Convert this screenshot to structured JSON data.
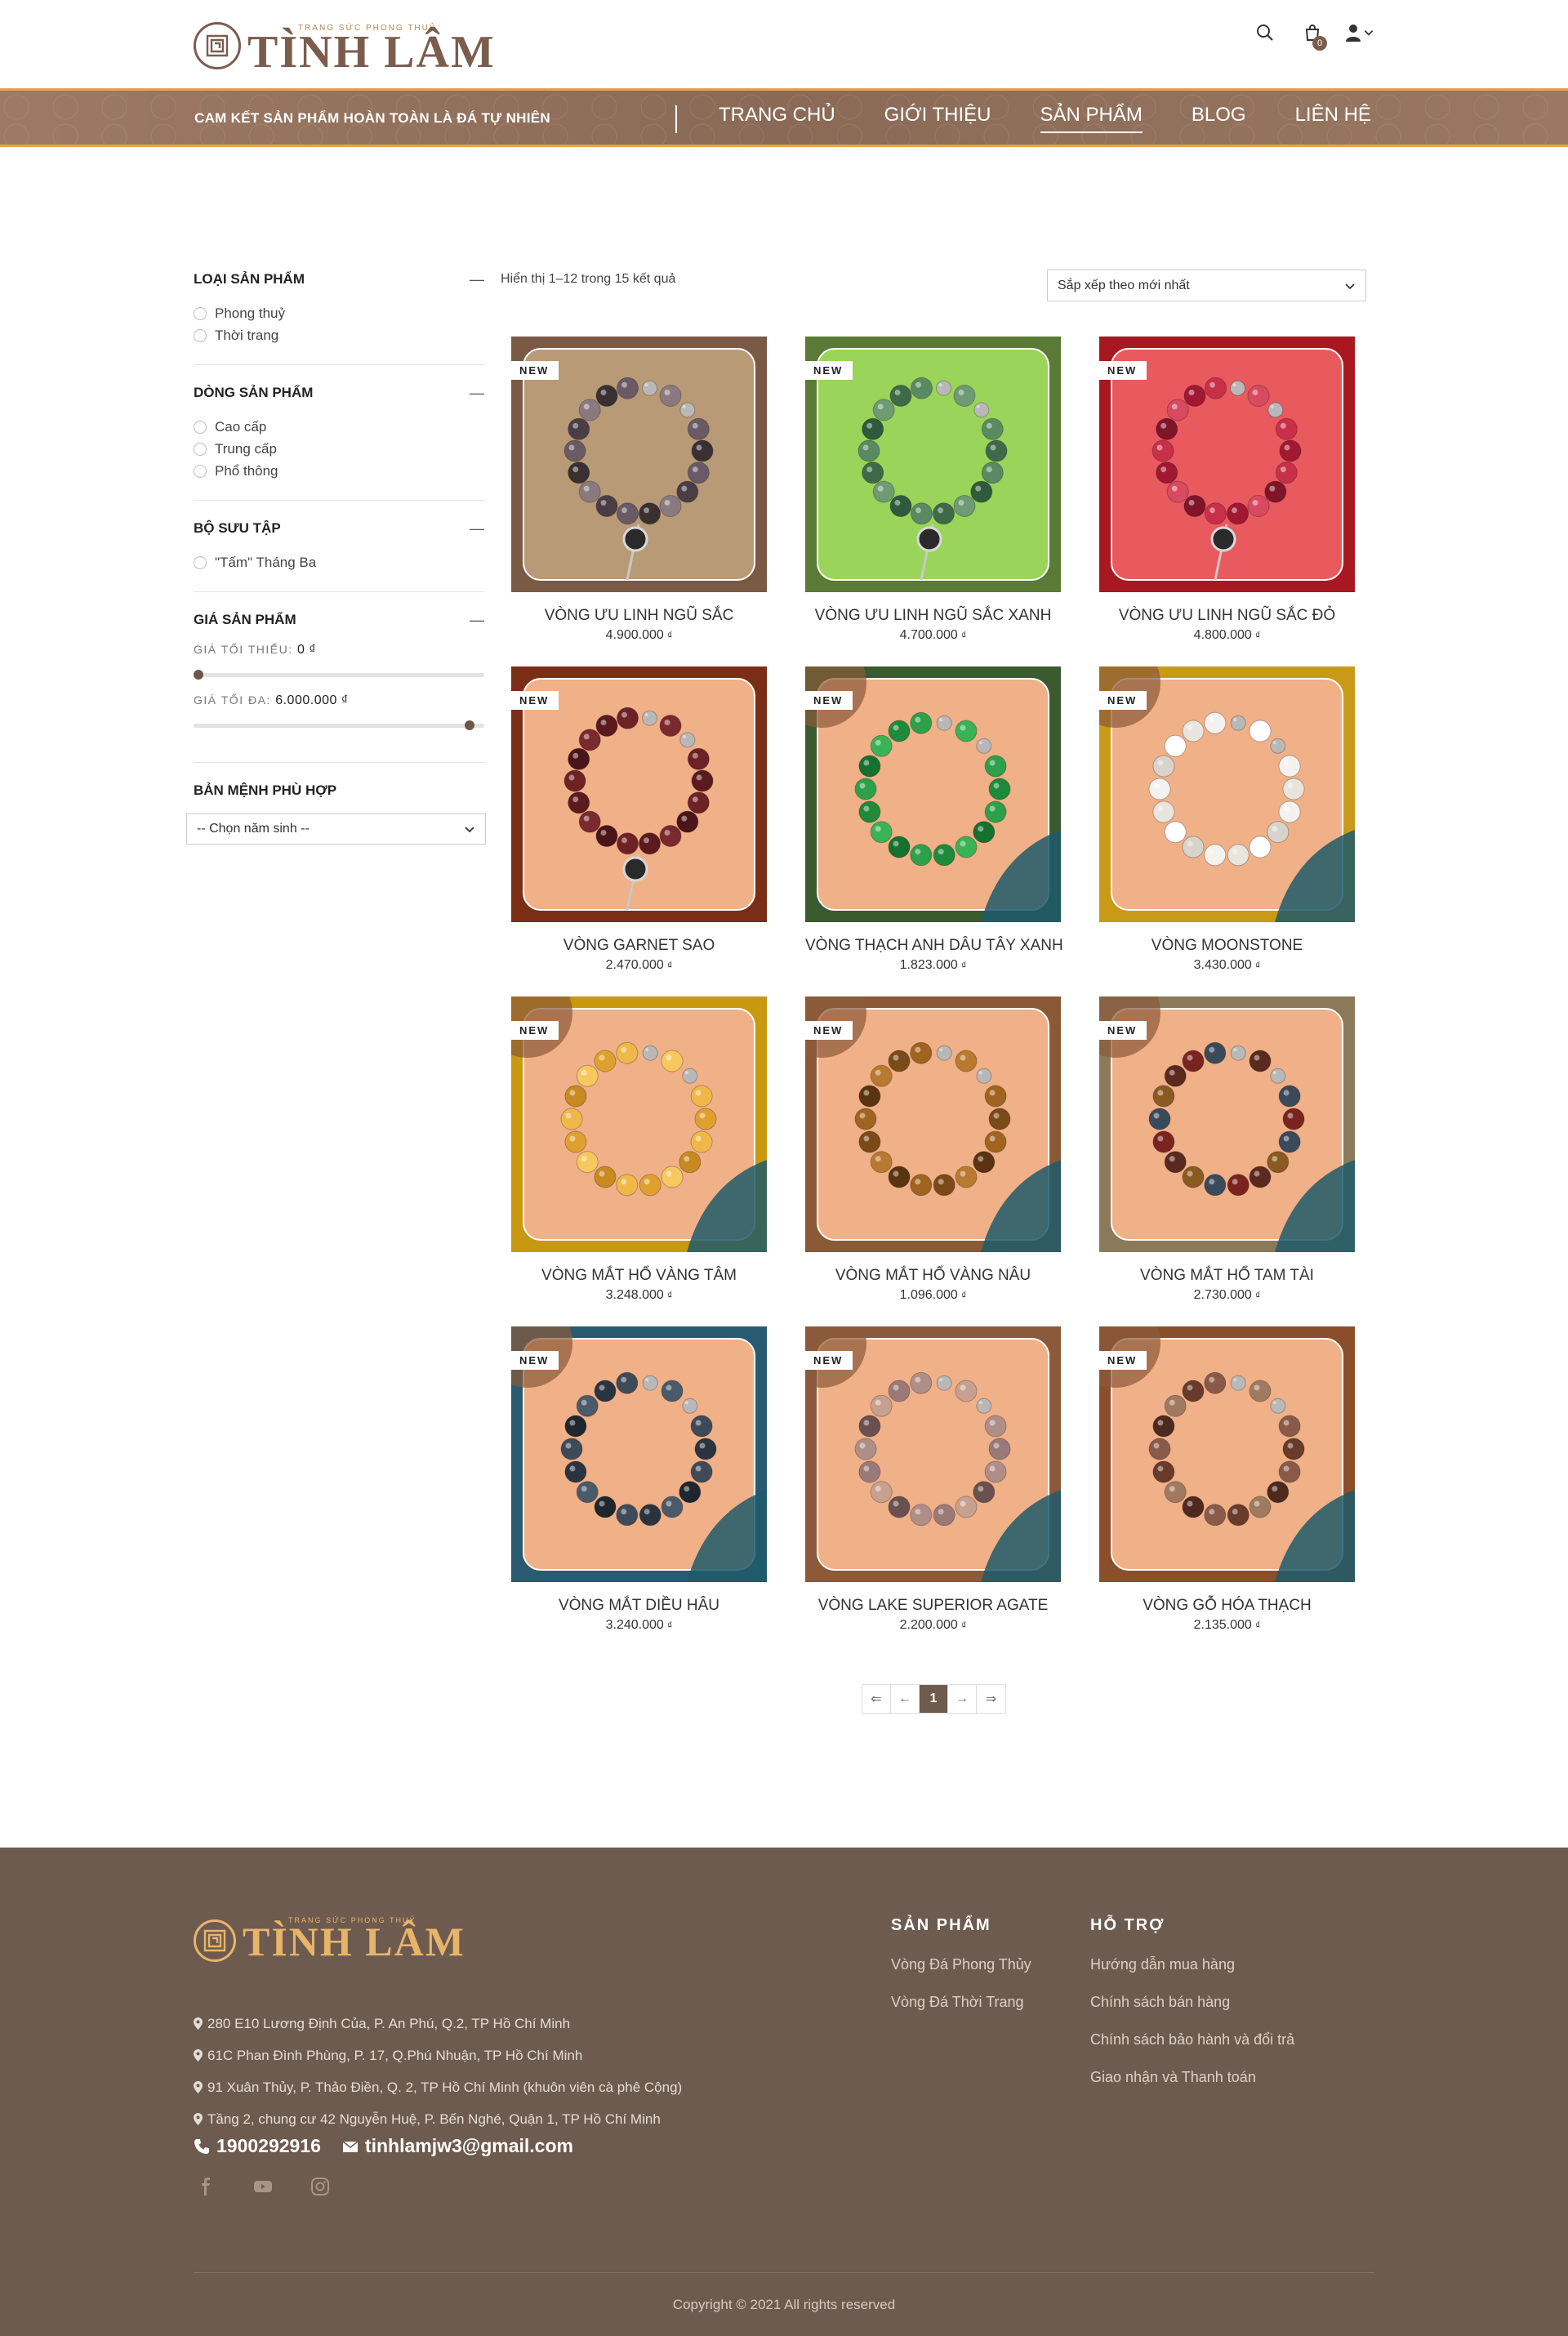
{
  "header": {
    "logo": {
      "tagline": "TRANG SỨC PHONG THUỶ",
      "name": "TÌNH LÂM"
    },
    "cart_count": "0",
    "promo": "CAM KẾT SẢN PHẨM HOÀN TOÀN LÀ ĐÁ TỰ NHIÊN",
    "nav": [
      "TRANG CHỦ",
      "GIỚI THIỆU",
      "SẢN PHẨM",
      "BLOG",
      "LIÊN HỆ"
    ],
    "nav_active": "SẢN PHẨM",
    "icons": [
      "search-icon",
      "cart-icon",
      "user-icon",
      "chevron-down-icon"
    ]
  },
  "sidebar": {
    "categories": {
      "title": "LOẠI SẢN PHẨM",
      "options": [
        "Phong thuỷ",
        "Thời trang"
      ]
    },
    "lines": {
      "title": "DÒNG SẢN PHẨM",
      "options": [
        "Cao cấp",
        "Trung cấp",
        "Phổ thông"
      ]
    },
    "collections": {
      "title": "BỘ SƯU TẬP",
      "options": [
        "\"Tấm\" Tháng Ba"
      ]
    },
    "price": {
      "title": "GIÁ SẢN PHẨM",
      "min_label": "GIÁ TỐI THIỂU:",
      "min_value": "0 ₫",
      "max_label": "GIÁ TỐI ĐA:",
      "max_value": "6.000.000 ₫",
      "min_fraction": 0,
      "max_fraction": 1
    },
    "birth": {
      "title": "BẢN MỆNH PHÙ HỢP",
      "placeholder": "-- Chọn năm sinh --"
    }
  },
  "listing": {
    "result_count": "Hiển thị 1–12 trong 15 kết quả",
    "sort": "Sắp xếp theo mới nhất",
    "badge": "NEW",
    "currency": "₫",
    "products": [
      {
        "name": "VÒNG ƯU LINH NGŨ SẮC",
        "price": "4.900.000",
        "bg": "#7a5a44",
        "inner": "#b89a76",
        "beads": [
          "#3a3032",
          "#6a5a66",
          "#4a3e44",
          "#8a7a80"
        ],
        "charm": true
      },
      {
        "name": "VÒNG ƯU LINH NGŨ SẮC XANH",
        "price": "4.700.000",
        "bg": "#5b7a36",
        "inner": "#9bd45a",
        "beads": [
          "#3e6a4a",
          "#5a8a62",
          "#2f5a3e",
          "#6e9a74"
        ],
        "charm": true
      },
      {
        "name": "VÒNG ƯU LINH NGŨ SẮC ĐỎ",
        "price": "4.800.000",
        "bg": "#a81820",
        "inner": "#e85a5e",
        "beads": [
          "#a01832",
          "#c8304a",
          "#801428",
          "#d84a60"
        ],
        "charm": true
      },
      {
        "name": "VÒNG GARNET SAO",
        "price": "2.470.000",
        "bg": "#7a2e16",
        "inner": "#f0b088",
        "beads": [
          "#5a1a1e",
          "#6e2226",
          "#4a1418",
          "#7a2a2e"
        ],
        "charm": true
      },
      {
        "name": "VÒNG THẠCH ANH DÂU TÂY XANH",
        "price": "1.823.000",
        "bg": "#3a5a30",
        "inner": "#f0b088",
        "beads": [
          "#1e8a3a",
          "#2ea04a",
          "#16702e",
          "#3ab256"
        ],
        "charm": false
      },
      {
        "name": "VÒNG MOONSTONE",
        "price": "3.430.000",
        "bg": "#c89a18",
        "inner": "#f0b088",
        "beads": [
          "#e8e4de",
          "#f4f2ee",
          "#d8d4cc",
          "#ffffff"
        ],
        "charm": false
      },
      {
        "name": "VÒNG MẮT HỔ VÀNG TÂM",
        "price": "3.248.000",
        "bg": "#c8980e",
        "inner": "#f0b088",
        "beads": [
          "#e0a030",
          "#f0b848",
          "#c88a20",
          "#f8c860"
        ],
        "charm": false
      },
      {
        "name": "VÒNG MẮT HỔ VÀNG NÂU",
        "price": "1.096.000",
        "bg": "#8a5a36",
        "inner": "#f0b088",
        "beads": [
          "#7a4a18",
          "#a06420",
          "#5a3410",
          "#b87a30"
        ],
        "charm": false
      },
      {
        "name": "VÒNG MẮT HỔ TAM TÀI",
        "price": "2.730.000",
        "bg": "#8a7a5a",
        "inner": "#f0b088",
        "beads": [
          "#7a2420",
          "#3a4a5a",
          "#8a5a20",
          "#5a2a1e"
        ],
        "charm": false
      },
      {
        "name": "VÒNG MẮT DIỀU HÂU",
        "price": "3.240.000",
        "bg": "#2a5a70",
        "inner": "#f0b088",
        "beads": [
          "#2a3440",
          "#3e4a58",
          "#1e262e",
          "#4a5a6a"
        ],
        "charm": false
      },
      {
        "name": "VÒNG LAKE SUPERIOR AGATE",
        "price": "2.200.000",
        "bg": "#8a5a3a",
        "inner": "#f0b088",
        "beads": [
          "#9a7a78",
          "#b08e88",
          "#6a5050",
          "#c8a090"
        ],
        "charm": false
      },
      {
        "name": "VÒNG GỖ HÓA THẠCH",
        "price": "2.135.000",
        "bg": "#8a4e2a",
        "inner": "#f0b088",
        "beads": [
          "#6a3a2a",
          "#8a5a48",
          "#4e2a1e",
          "#a07a60"
        ],
        "charm": false
      }
    ]
  },
  "pagination": {
    "first": "⇐",
    "prev": "←",
    "current": "1",
    "next": "→",
    "last": "⇒"
  },
  "footer": {
    "logo": {
      "tagline": "TRANG SỨC PHONG THUỶ",
      "name": "TÌNH LÂM"
    },
    "addresses": [
      "280 E10 Lương Định Của, P. An Phú, Q.2, TP Hồ Chí Minh",
      "61C Phan Đình Phùng, P. 17, Q.Phú Nhuận, TP Hồ Chí Minh",
      "91 Xuân Thủy, P. Thảo Điền, Q. 2, TP Hồ Chí Minh (khuôn viên cà phê Cộng)",
      "Tầng 2, chung cư 42 Nguyễn Huệ, P. Bến Nghé, Quận 1, TP Hồ Chí Minh"
    ],
    "phone": "1900292916",
    "email": "tinhlamjw3@gmail.com",
    "social": [
      "facebook-icon",
      "youtube-icon",
      "instagram-icon"
    ],
    "products_col": {
      "title": "SẢN PHẨM",
      "links": [
        "Vòng Đá Phong Thủy",
        "Vòng Đá Thời Trang"
      ]
    },
    "support_col": {
      "title": "HỖ TRỢ",
      "links": [
        "Hướng dẫn mua hàng",
        "Chính sách bán hàng",
        "Chính sách bảo hành và đổi trả",
        "Giao nhận và Thanh toán"
      ]
    },
    "copyright": "Copyright © 2021 All rights reserved"
  },
  "colors": {
    "brand": "#7b5d4e",
    "nav_border": "#e8a44a",
    "footer_bg": "#6e5b4f",
    "footer_logo": "#e8b46a"
  }
}
